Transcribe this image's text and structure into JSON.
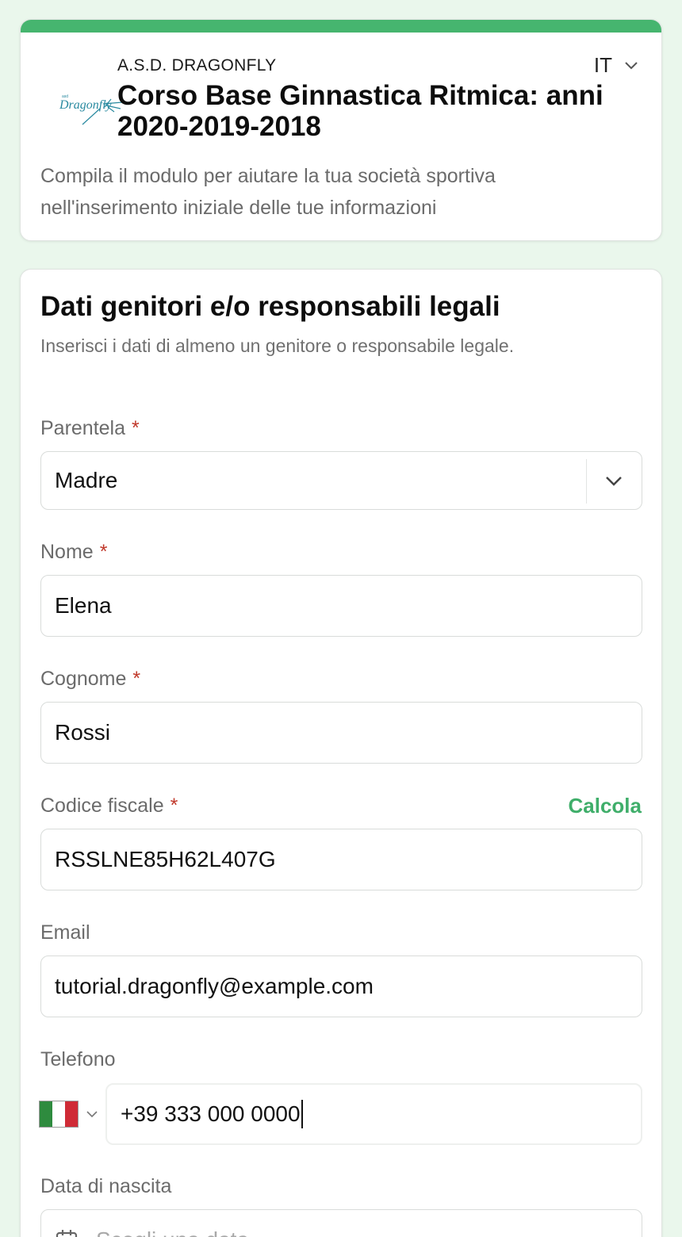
{
  "header": {
    "org_name": "A.S.D. DRAGONFLY",
    "form_title": "Corso Base Ginnastica Ritmica: anni 2020-2019-2018",
    "language": "IT",
    "intro": "Compila il modulo per aiutare la tua società sportiva nell'inserimento iniziale delle tue informazioni",
    "accent_color": "#46b56f",
    "logo": {
      "text": "Dragonfly",
      "small_text": "asd",
      "icon": "dragonfly-logo"
    }
  },
  "section": {
    "title": "Dati genitori e/o responsabili legali",
    "subtitle": "Inserisci i dati di almeno un genitore o responsabile legale."
  },
  "fields": {
    "parentela": {
      "label": "Parentela",
      "required_mark": "*",
      "value": "Madre"
    },
    "nome": {
      "label": "Nome",
      "required_mark": "*",
      "value": "Elena"
    },
    "cognome": {
      "label": "Cognome",
      "required_mark": "*",
      "value": "Rossi"
    },
    "codice_fiscale": {
      "label": "Codice fiscale",
      "required_mark": "*",
      "value": "RSSLNE85H62L407G",
      "action": "Calcola"
    },
    "email": {
      "label": "Email",
      "value": "tutorial.dragonfly@example.com"
    },
    "telefono": {
      "label": "Telefono",
      "country_flag": "italy-flag",
      "value": "+39 333 000 0000"
    },
    "data_nascita": {
      "label": "Data di nascita",
      "placeholder": "Scegli una data"
    }
  }
}
